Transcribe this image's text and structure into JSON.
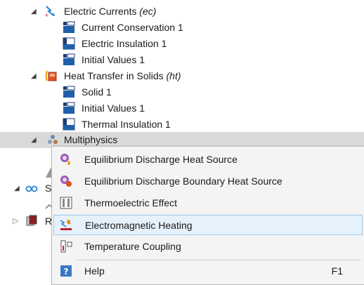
{
  "tree": {
    "ec": {
      "name": "Electric Currents",
      "tag": "(ec)"
    },
    "ec_children": [
      "Current Conservation 1",
      "Electric Insulation 1",
      "Initial Values 1"
    ],
    "ht": {
      "name": "Heat Transfer in Solids",
      "tag": "(ht)"
    },
    "ht_children": [
      "Solid 1",
      "Initial Values 1",
      "Thermal Insulation 1"
    ],
    "multiphysics": "Multiphysics",
    "partial_s": "S",
    "partial_r": "R"
  },
  "context_menu": {
    "items": [
      "Equilibrium Discharge Heat Source",
      "Equilibrium Discharge Boundary Heat Source",
      "Thermoelectric Effect",
      "Electromagnetic Heating",
      "Temperature Coupling"
    ],
    "help": {
      "label": "Help",
      "shortcut": "F1"
    }
  }
}
